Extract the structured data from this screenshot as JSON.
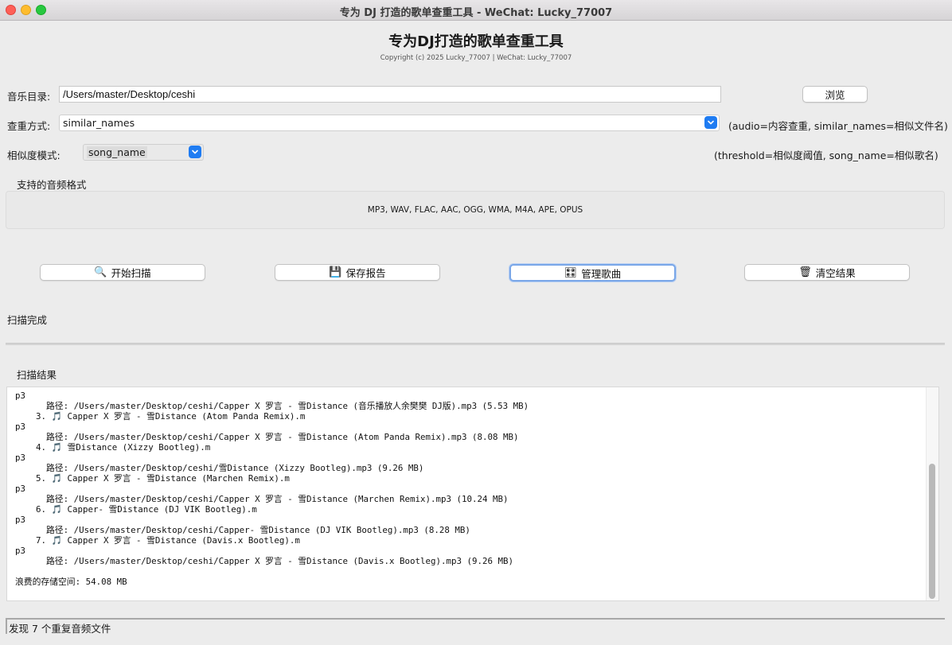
{
  "window": {
    "title": "专为 DJ 打造的歌单查重工具 - WeChat: Lucky_77007"
  },
  "header": {
    "title": "专为DJ打造的歌单查重工具",
    "copyright": "Copyright (c) 2025 Lucky_77007 | WeChat: Lucky_77007"
  },
  "form": {
    "music_dir_label": "音乐目录:",
    "music_dir_value": "/Users/master/Desktop/ceshi",
    "browse_label": "浏览",
    "method_label": "查重方式:",
    "method_value": "similar_names",
    "method_hint": "(audio=内容查重, similar_names=相似文件名)",
    "similarity_label": "相似度模式:",
    "similarity_value": "song_name",
    "similarity_hint": "(threshold=相似度阈值, song_name=相似歌名)"
  },
  "formats": {
    "heading": "支持的音频格式",
    "list": "MP3, WAV, FLAC, AAC, OGG, WMA, M4A, APE, OPUS"
  },
  "actions": {
    "scan": {
      "icon": "🔍",
      "label": "开始扫描"
    },
    "save": {
      "icon": "💾",
      "label": "保存报告"
    },
    "manage": {
      "icon": "🎛",
      "label": "管理歌曲"
    },
    "clear": {
      "icon": "🗑",
      "label": "清空结果"
    }
  },
  "status_text": "扫描完成",
  "results": {
    "heading": "扫描结果",
    "lines": [
      "p3",
      "      路径: /Users/master/Desktop/ceshi/Capper X 罗言 - 雪Distance (音乐播放人余樊樊 DJ版).mp3 (5.53 MB)",
      "    3. 🎵 Capper X 罗言 - 雪Distance (Atom Panda Remix).m",
      "p3",
      "      路径: /Users/master/Desktop/ceshi/Capper X 罗言 - 雪Distance (Atom Panda Remix).mp3 (8.08 MB)",
      "    4. 🎵 雪Distance (Xizzy Bootleg).m",
      "p3",
      "      路径: /Users/master/Desktop/ceshi/雪Distance (Xizzy Bootleg).mp3 (9.26 MB)",
      "    5. 🎵 Capper X 罗言 - 雪Distance (Marchen Remix).m",
      "p3",
      "      路径: /Users/master/Desktop/ceshi/Capper X 罗言 - 雪Distance (Marchen Remix).mp3 (10.24 MB)",
      "    6. 🎵 Capper- 雪Distance (DJ VIK Bootleg).m",
      "p3",
      "      路径: /Users/master/Desktop/ceshi/Capper- 雪Distance (DJ VIK Bootleg).mp3 (8.28 MB)",
      "    7. 🎵 Capper X 罗言 - 雪Distance (Davis.x Bootleg).m",
      "p3",
      "      路径: /Users/master/Desktop/ceshi/Capper X 罗言 - 雪Distance (Davis.x Bootleg).mp3 (9.26 MB)",
      "",
      "浪费的存储空间: 54.08 MB"
    ]
  },
  "statusbar": {
    "text": "发现 7 个重复音频文件"
  },
  "colors": {
    "accent": "#1f7cf2",
    "close": "#fe5f57",
    "minimize": "#febc2e",
    "maximize": "#28c840"
  }
}
